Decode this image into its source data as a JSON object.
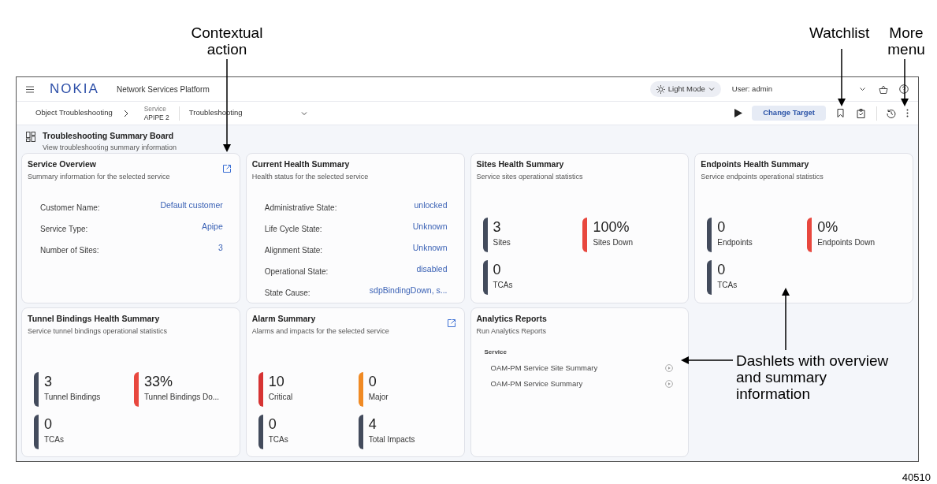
{
  "callouts": [
    {
      "text": "Contextual action"
    },
    {
      "text": "Watchlist"
    },
    {
      "text": "More menu"
    },
    {
      "text": "Dashlets with overview and summary information"
    }
  ],
  "figure_number": "40510",
  "top_bar": {
    "logo": "NOKIA",
    "app_name": "Network Services Platform",
    "theme_button": "Light Mode",
    "user": "User: admin"
  },
  "breadcrumb": {
    "root": "Object Troubleshooting",
    "object_type": "Service",
    "object_name": "APIPE 2",
    "view": "Troubleshooting",
    "action_button": "Change Target"
  },
  "board": {
    "title": "Troubleshooting Summary Board",
    "subtitle": "View troubleshooting summary information"
  },
  "dashlets": [
    {
      "kind": "fields",
      "title": "Service Overview",
      "subtitle": "Summary information for the selected service",
      "action_icon": true,
      "fields": [
        {
          "label": "Customer Name:",
          "value": "Default customer"
        },
        {
          "label": "Service Type:",
          "value": "Apipe"
        },
        {
          "label": "Number of Sites:",
          "value": "3"
        }
      ]
    },
    {
      "kind": "fields",
      "title": "Current Health Summary",
      "subtitle": "Health status for the selected service",
      "action_icon": false,
      "fields": [
        {
          "label": "Administrative State:",
          "value": "unlocked"
        },
        {
          "label": "Life Cycle State:",
          "value": "Unknown"
        },
        {
          "label": "Alignment State:",
          "value": "Unknown"
        },
        {
          "label": "Operational State:",
          "value": "disabled"
        },
        {
          "label": "State Cause:",
          "value": "sdpBindingDown, s..."
        }
      ]
    },
    {
      "kind": "stats",
      "title": "Sites Health Summary",
      "subtitle": "Service sites operational statistics",
      "action_icon": false,
      "stats": [
        {
          "value": "3",
          "label": "Sites",
          "color": "#434b5c"
        },
        {
          "value": "100%",
          "label": "Sites Down",
          "color": "#e8473e"
        },
        {
          "value": "0",
          "label": "TCAs",
          "color": "#434b5c"
        }
      ]
    },
    {
      "kind": "stats",
      "title": "Endpoints Health Summary",
      "subtitle": "Service endpoints operational statistics",
      "action_icon": false,
      "stats": [
        {
          "value": "0",
          "label": "Endpoints",
          "color": "#434b5c"
        },
        {
          "value": "0%",
          "label": "Endpoints Down",
          "color": "#e8473e"
        },
        {
          "value": "0",
          "label": "TCAs",
          "color": "#434b5c"
        }
      ]
    },
    {
      "kind": "stats",
      "title": "Tunnel Bindings Health Summary",
      "subtitle": "Service tunnel bindings operational statistics",
      "action_icon": false,
      "stats": [
        {
          "value": "3",
          "label": "Tunnel Bindings",
          "color": "#434b5c"
        },
        {
          "value": "33%",
          "label": "Tunnel Bindings Do...",
          "color": "#e8473e"
        },
        {
          "value": "0",
          "label": "TCAs",
          "color": "#434b5c"
        }
      ]
    },
    {
      "kind": "stats",
      "title": "Alarm Summary",
      "subtitle": "Alarms and impacts for the selected service",
      "action_icon": true,
      "stats": [
        {
          "value": "10",
          "label": "Critical",
          "color": "#d63333"
        },
        {
          "value": "0",
          "label": "Major",
          "color": "#f08a24"
        },
        {
          "value": "0",
          "label": "TCAs",
          "color": "#434b5c"
        },
        {
          "value": "4",
          "label": "Total Impacts",
          "color": "#434b5c"
        }
      ]
    },
    {
      "kind": "reports",
      "title": "Analytics Reports",
      "subtitle": "Run Analytics Reports",
      "action_icon": false,
      "group": "Service",
      "reports": [
        {
          "name": "OAM-PM Service Site Summary"
        },
        {
          "name": "OAM-PM Service Summary"
        }
      ]
    }
  ]
}
